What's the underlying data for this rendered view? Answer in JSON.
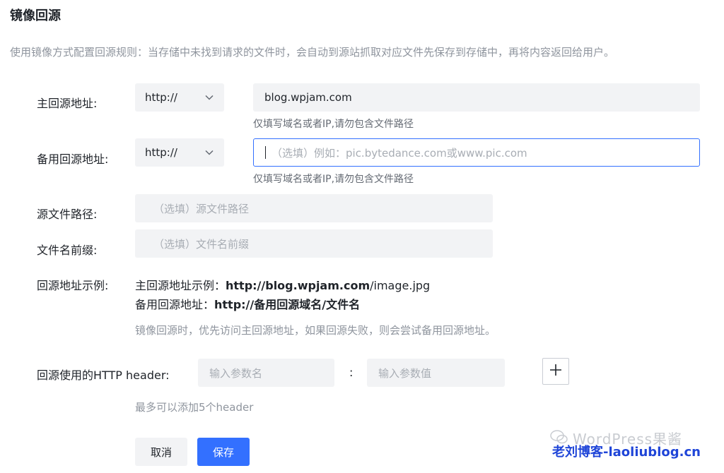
{
  "page": {
    "title": "镜像回源",
    "description": "使用镜像方式配置回源规则：当存储中未找到请求的文件时，会自动到源站抓取对应文件先保存到存储中，再将内容返回给用户。"
  },
  "primary": {
    "label": "主回源地址:",
    "protocol": "http://",
    "value": "blog.wpjam.com",
    "hint": "仅填写域名或者IP,请勿包含文件路径"
  },
  "backup": {
    "label": "备用回源地址:",
    "protocol": "http://",
    "placeholder": "（选填）例如：pic.bytedance.com或www.pic.com",
    "hint": "仅填写域名或者IP,请勿包含文件路径"
  },
  "source_path": {
    "label": "源文件路径:",
    "placeholder": "（选填）源文件路径"
  },
  "filename_prefix": {
    "label": "文件名前缀:",
    "placeholder": "（选填）文件名前缀"
  },
  "example": {
    "label": "回源地址示例:",
    "primary_prefix": "主回源地址示例：",
    "primary_url_bold": "http://blog.wpjam.com",
    "primary_url_rest": "/image.jpg",
    "backup_prefix": "备用回源地址：",
    "backup_url": "http://备用回源域名/文件名",
    "note": "镜像回源时，优先访问主回源地址，如果回源失败，则会尝试备用回源地址。"
  },
  "http_header": {
    "label": "回源使用的HTTP header:",
    "name_placeholder": "输入参数名",
    "separator": ":",
    "value_placeholder": "输入参数值",
    "hint": "最多可以添加5个header"
  },
  "actions": {
    "cancel": "取消",
    "save": "保存"
  },
  "watermark": {
    "line1": "WordPress果酱",
    "line2": "老刘博客-laoliublog.cn"
  },
  "colors": {
    "accent": "#3370ff",
    "input_bg": "#f2f3f5",
    "muted_text": "#8f959e"
  }
}
